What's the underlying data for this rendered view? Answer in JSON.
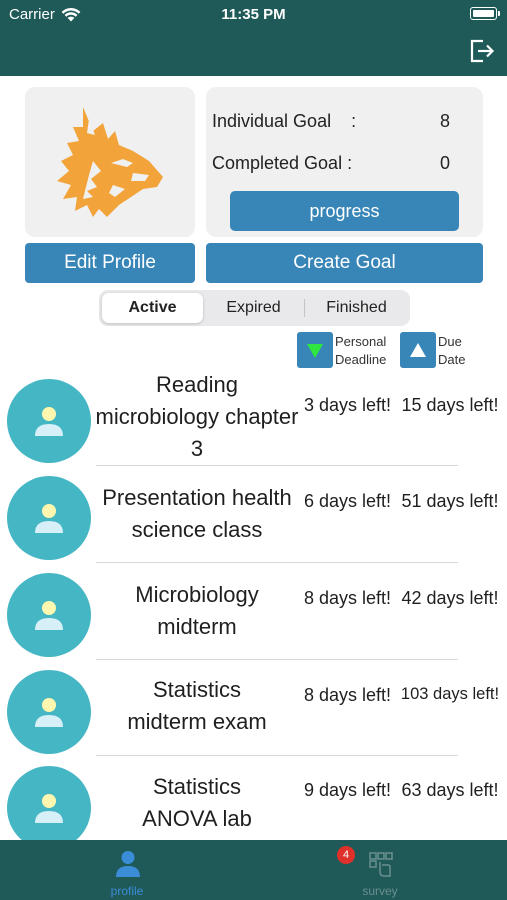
{
  "status_bar": {
    "carrier": "Carrier",
    "time": "11:35 PM"
  },
  "nav": {
    "logout_icon": "logout-icon"
  },
  "profile": {
    "avatar_icon": "wolf-logo",
    "individual_goal_label": "Individual Goal    :",
    "individual_goal_value": "8",
    "completed_goal_label": "Completed Goal :",
    "completed_goal_value": "0",
    "progress_label": "progress",
    "edit_label": "Edit Profile",
    "create_label": "Create Goal"
  },
  "tabs": [
    {
      "label": "Active",
      "selected": true
    },
    {
      "label": "Expired",
      "selected": false
    },
    {
      "label": "Finished",
      "selected": false
    }
  ],
  "sort": {
    "personal_line1": "Personal",
    "personal_line2": "Deadline",
    "due_line1": "Due",
    "due_line2": "Date",
    "personal_arrow_color": "#2ee63f",
    "due_arrow_color": "#ffffff"
  },
  "goals": [
    {
      "title_lines": [
        "Reading",
        "microbiology chapter",
        "3"
      ],
      "personal": "3 days left!",
      "due": "15 days left!"
    },
    {
      "title_lines": [
        "Presentation health",
        "science class"
      ],
      "personal": "6 days left!",
      "due": "51 days left!"
    },
    {
      "title_lines": [
        "Microbiology",
        "midterm"
      ],
      "personal": "8 days left!",
      "due": "42 days left!"
    },
    {
      "title_lines": [
        "Statistics",
        "midterm exam"
      ],
      "personal": "8 days left!",
      "due": "103 days left!"
    },
    {
      "title_lines": [
        "Statistics",
        "ANOVA lab"
      ],
      "personal": "9 days left!",
      "due": "63 days left!"
    }
  ],
  "tabbar": {
    "profile_label": "profile",
    "survey_label": "survey",
    "survey_badge": "4"
  },
  "colors": {
    "nav_bg": "#1f5a59",
    "button_blue": "#3886b8",
    "avatar_circle": "#45b6c4",
    "wolf_orange": "#f2a43a",
    "active_tab": "#3c8dd8"
  }
}
